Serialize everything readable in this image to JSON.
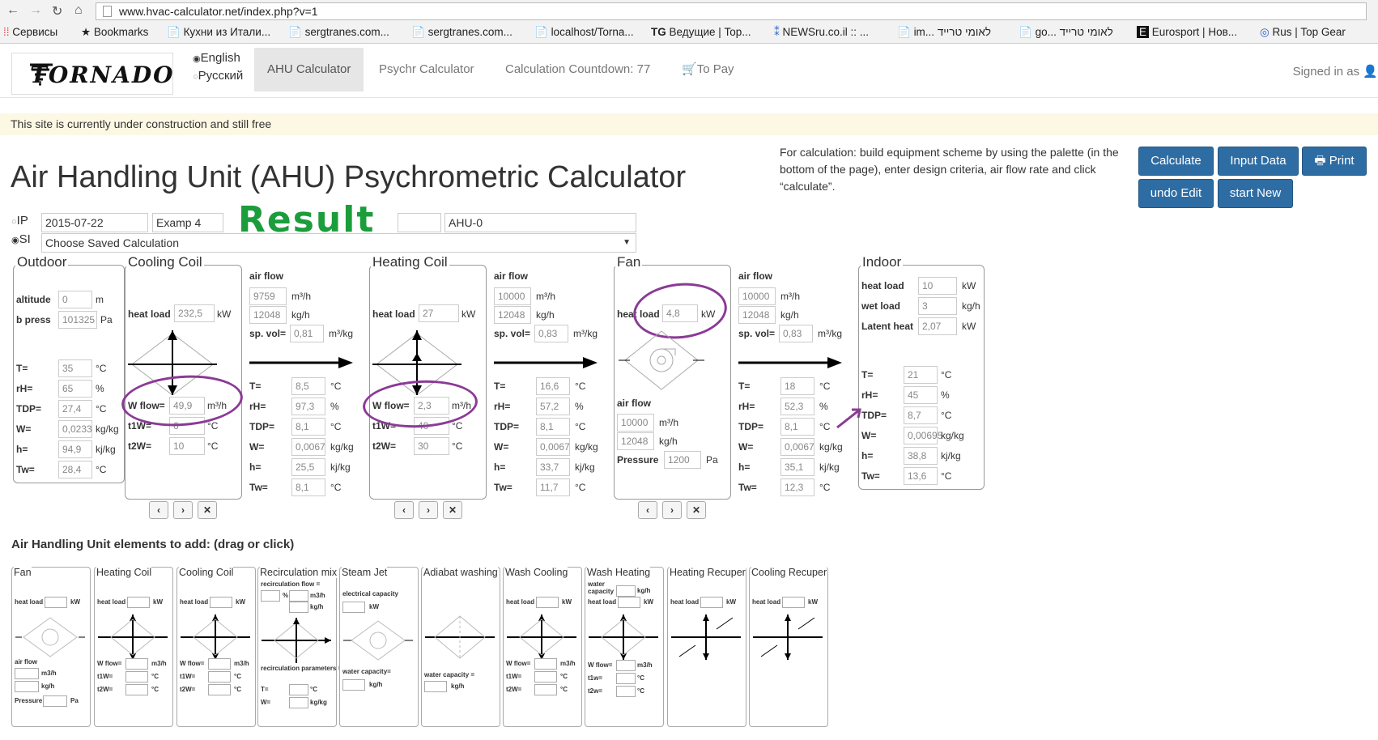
{
  "browser": {
    "url": "www.hvac-calculator.net/index.php?v=1",
    "bookmarks": [
      "Сервисы",
      "Bookmarks",
      "Кухни из Итали...",
      "sergtranes.com...",
      "sergtranes.com...",
      "localhost/Torna...",
      "Ведущие | Top...",
      "NEWSru.co.il :: ...",
      "im... לאומי טרייד",
      "go... לאומי טרייד",
      "Eurosport | Нов...",
      "Rus | Top Gear"
    ],
    "bookmark_icons": [
      "TG"
    ]
  },
  "header": {
    "logo_text": "TORNADO",
    "lang_english": "English",
    "lang_russian": "Русский",
    "nav": [
      "AHU Calculator",
      "Psychr Calculator",
      "Calculation Countdown: 77",
      "To Pay"
    ],
    "signed_in": "Signed in as"
  },
  "alert": "This site is currently under construction and still free",
  "title": "Air Handling Unit (AHU) Psychrometric Calculator",
  "help_text": "For calculation: build equipment scheme by using the palette (in the bottom of the page), enter design criteria, air flow rate and click “calculate”.",
  "buttons": {
    "calculate": "Calculate",
    "input_data": "Input Data",
    "print": "Print",
    "undo": "undo Edit",
    "start_new": "start New"
  },
  "form": {
    "ip": "IP",
    "si": "SI",
    "date": "2015-07-22",
    "name": "Examp 4",
    "ahu": "AHU-0",
    "saved": "Choose Saved Calculation",
    "result": "Result"
  },
  "outdoor": {
    "title": "Outdoor",
    "altitude": {
      "label": "altitude",
      "value": "0",
      "unit": "m"
    },
    "bpress": {
      "label": "b press",
      "value": "101325",
      "unit": "Pa"
    },
    "rows": [
      {
        "label": "T=",
        "value": "35",
        "unit": "°C"
      },
      {
        "label": "rH=",
        "value": "65",
        "unit": "%"
      },
      {
        "label": "TDP=",
        "value": "27,4",
        "unit": "°C"
      },
      {
        "label": "W=",
        "value": "0,0233",
        "unit": "kg/kg"
      },
      {
        "label": "h=",
        "value": "94,9",
        "unit": "kj/kg"
      },
      {
        "label": "Tw=",
        "value": "28,4",
        "unit": "°C"
      }
    ]
  },
  "cooling": {
    "title": "Cooling Coil",
    "heat_load": {
      "label": "heat load",
      "value": "232,5",
      "unit": "kW"
    },
    "wflow": {
      "label": "W flow=",
      "value": "49,9",
      "unit": "m³/h"
    },
    "t1w": {
      "label": "t1W=",
      "value": "6",
      "unit": "°C"
    },
    "t2w": {
      "label": "t2W=",
      "value": "10",
      "unit": "°C"
    }
  },
  "heating": {
    "title": "Heating Coil",
    "heat_load": {
      "label": "heat load",
      "value": "27",
      "unit": "kW"
    },
    "wflow": {
      "label": "W flow=",
      "value": "2,3",
      "unit": "m³/h"
    },
    "t1w": {
      "label": "t1W=",
      "value": "40",
      "unit": "°C"
    },
    "t2w": {
      "label": "t2W=",
      "value": "30",
      "unit": "°C"
    }
  },
  "fan": {
    "title": "Fan",
    "heat_load": {
      "label": "heat load",
      "value": "4,8",
      "unit": "kW"
    },
    "air_flow_label": "air flow",
    "flow_m3": {
      "value": "10000",
      "unit": "m³/h"
    },
    "flow_kg": {
      "value": "12048",
      "unit": "kg/h"
    },
    "pressure": {
      "label": "Pressure",
      "value": "1200",
      "unit": "Pa"
    }
  },
  "streams": [
    {
      "air_flow": "air flow",
      "m3": "9759",
      "kg": "12048",
      "spvol": "0,81",
      "T": "8,5",
      "rH": "97,3",
      "TDP": "8,1",
      "W": "0,0067",
      "h": "25,5",
      "Tw": "8,1"
    },
    {
      "air_flow": "air flow",
      "m3": "10000",
      "kg": "12048",
      "spvol": "0,83",
      "T": "16,6",
      "rH": "57,2",
      "TDP": "8,1",
      "W": "0,0067",
      "h": "33,7",
      "Tw": "11,7"
    },
    {
      "air_flow": "air flow",
      "m3": "10000",
      "kg": "12048",
      "spvol": "0,83",
      "T": "18",
      "rH": "52,3",
      "TDP": "8,1",
      "W": "0,0067",
      "h": "35,1",
      "Tw": "12,3"
    }
  ],
  "stream_labels": {
    "m3_unit": "m³/h",
    "kg_unit": "kg/h",
    "spvol": "sp. vol=",
    "spvol_unit": "m³/kg",
    "T": "T=",
    "rH": "rH=",
    "TDP": "TDP=",
    "W": "W=",
    "h": "h=",
    "Tw": "Tw=",
    "c": "°C",
    "pct": "%",
    "kgkg": "kg/kg",
    "kjkg": "kj/kg"
  },
  "indoor": {
    "title": "Indoor",
    "heat_load": {
      "label": "heat load",
      "value": "10",
      "unit": "kW"
    },
    "wet_load": {
      "label": "wet load",
      "value": "3",
      "unit": "kg/h"
    },
    "latent": {
      "label": "Latent heat",
      "value": "2,07",
      "unit": "kW"
    },
    "rows": [
      {
        "label": "T=",
        "value": "21",
        "unit": "°C"
      },
      {
        "label": "rH=",
        "value": "45",
        "unit": "%"
      },
      {
        "label": "TDP=",
        "value": "8,7",
        "unit": "°C"
      },
      {
        "label": "W=",
        "value": "0,00695",
        "unit": "kg/kg"
      },
      {
        "label": "h=",
        "value": "38,8",
        "unit": "kj/kg"
      },
      {
        "label": "Tw=",
        "value": "13,6",
        "unit": "°C"
      }
    ]
  },
  "controls": [
    "‹",
    "›",
    "✕"
  ],
  "palette": {
    "title": "Air Handling Unit elements to add: (drag or click)",
    "items": [
      "Fan",
      "Heating Coil",
      "Cooling Coil",
      "Recirculation mix",
      "Steam Jet",
      "Adiabat washing",
      "Wash Cooling",
      "Wash Heating",
      "Heating Recuper",
      "Cooling Recuper"
    ],
    "labels": {
      "heat_load": "heat load",
      "kw": "kW",
      "air_flow": "air flow",
      "m3h": "m3/h",
      "kgh": "kg/h",
      "pressure": "Pressure",
      "pa": "Pa",
      "wflow": "W flow=",
      "t1w": "t1W=",
      "t2w": "t2W=",
      "c": "°C",
      "recirc_flow": "recirculation flow =",
      "pct": "%",
      "recirc_params": "recirculation parameters =",
      "T": "T=",
      "W": "W=",
      "kgkg": "kg/kg",
      "elec": "electrical capacity",
      "water_cap": "water capacity=",
      "water_cap2": "water capacity =",
      "water": "water",
      "capacity": "capacity",
      "t1w_l": "t1w=",
      "t2w_l": "t2w="
    }
  }
}
